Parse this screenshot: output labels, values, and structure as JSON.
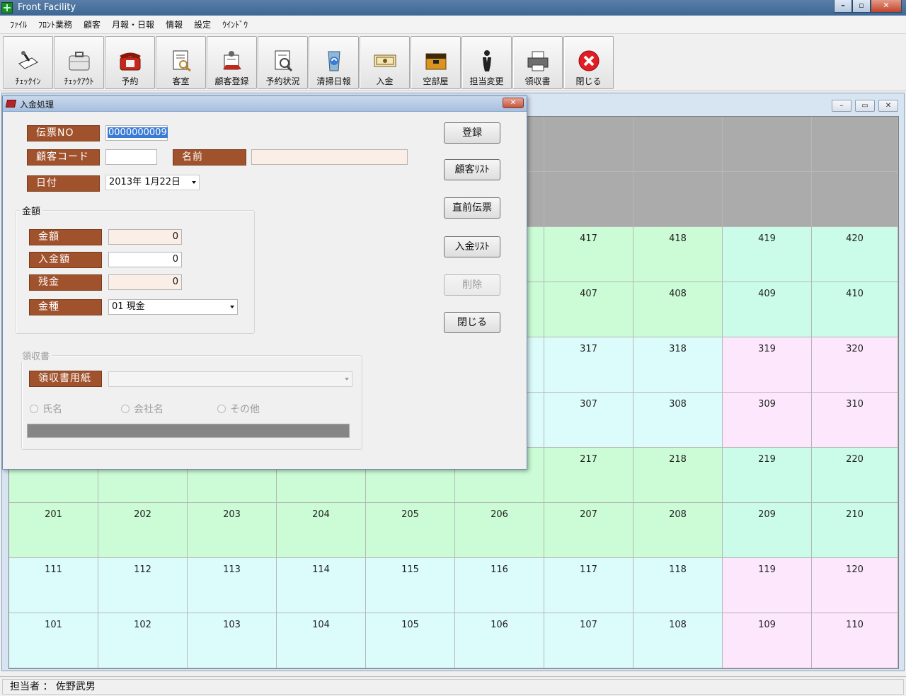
{
  "app": {
    "title": "Front Facility"
  },
  "menu": [
    "ﾌｧｲﾙ",
    "ﾌﾛﾝﾄ業務",
    "顧客",
    "月報・日報",
    "情報",
    "設定",
    "ｳｲﾝﾄﾞｳ"
  ],
  "toolbar": [
    {
      "label": "ﾁｪｯｸｲﾝ",
      "icon": "checkin-icon"
    },
    {
      "label": "ﾁｪｯｸｱｳﾄ",
      "icon": "checkout-icon"
    },
    {
      "label": "予約",
      "icon": "phone-icon"
    },
    {
      "label": "客室",
      "icon": "room-icon"
    },
    {
      "label": "顧客登録",
      "icon": "customer-register-icon"
    },
    {
      "label": "予約状況",
      "icon": "reservation-status-icon"
    },
    {
      "label": "清掃日報",
      "icon": "cleaning-icon"
    },
    {
      "label": "入金",
      "icon": "payment-icon"
    },
    {
      "label": "空部屋",
      "icon": "vacant-room-icon"
    },
    {
      "label": "担当変更",
      "icon": "staff-change-icon"
    },
    {
      "label": "領収書",
      "icon": "printer-icon"
    },
    {
      "label": "閉じる",
      "icon": "close-icon"
    }
  ],
  "grid": {
    "rows": [
      {
        "color": "gray",
        "cells": [
          "",
          "",
          "",
          "",
          "",
          "",
          "",
          "",
          "",
          ""
        ]
      },
      {
        "color": "gray",
        "cells": [
          "",
          "",
          "",
          "",
          "",
          "",
          "",
          "",
          "",
          ""
        ]
      },
      {
        "color": "mixed",
        "cells": [
          "",
          "",
          "",
          "",
          "",
          "",
          "417",
          "418",
          "419",
          "420"
        ],
        "cellColors": [
          "green",
          "green",
          "green",
          "green",
          "green",
          "green",
          "green",
          "green",
          "mint",
          "mint"
        ]
      },
      {
        "color": "mixed",
        "cells": [
          "",
          "",
          "",
          "",
          "",
          "",
          "407",
          "408",
          "409",
          "410"
        ],
        "cellColors": [
          "green",
          "green",
          "green",
          "green",
          "green",
          "green",
          "green",
          "green",
          "mint",
          "mint"
        ]
      },
      {
        "color": "mixed",
        "cells": [
          "",
          "",
          "",
          "",
          "",
          "",
          "317",
          "318",
          "319",
          "320"
        ],
        "cellColors": [
          "cyan",
          "cyan",
          "cyan",
          "cyan",
          "cyan",
          "cyan",
          "cyan",
          "cyan",
          "pink",
          "pink"
        ]
      },
      {
        "color": "mixed",
        "cells": [
          "",
          "",
          "",
          "",
          "",
          "",
          "307",
          "308",
          "309",
          "310"
        ],
        "cellColors": [
          "cyan",
          "cyan",
          "cyan",
          "cyan",
          "cyan",
          "cyan",
          "cyan",
          "cyan",
          "pink",
          "pink"
        ]
      },
      {
        "color": "mixed",
        "cells": [
          "",
          "",
          "",
          "",
          "",
          "",
          "217",
          "218",
          "219",
          "220"
        ],
        "cellColors": [
          "green",
          "green",
          "green",
          "green",
          "green",
          "green",
          "green",
          "green",
          "mint",
          "mint"
        ]
      },
      {
        "color": "mixed",
        "cells": [
          "201",
          "202",
          "203",
          "204",
          "205",
          "206",
          "207",
          "208",
          "209",
          "210"
        ],
        "cellColors": [
          "green",
          "green",
          "green",
          "green",
          "green",
          "green",
          "green",
          "green",
          "mint",
          "mint"
        ]
      },
      {
        "color": "mixed",
        "cells": [
          "111",
          "112",
          "113",
          "114",
          "115",
          "116",
          "117",
          "118",
          "119",
          "120"
        ],
        "cellColors": [
          "cyan",
          "cyan",
          "cyan",
          "cyan",
          "cyan",
          "cyan",
          "cyan",
          "cyan",
          "pink",
          "pink"
        ]
      },
      {
        "color": "mixed",
        "cells": [
          "101",
          "102",
          "103",
          "104",
          "105",
          "106",
          "107",
          "108",
          "109",
          "110"
        ],
        "cellColors": [
          "cyan",
          "cyan",
          "cyan",
          "cyan",
          "cyan",
          "cyan",
          "cyan",
          "cyan",
          "pink",
          "pink"
        ]
      }
    ],
    "colors": {
      "gray": "#ababab",
      "green": "#ccfcd6",
      "cyan": "#dcfcfc",
      "mint": "#cbfcea",
      "pink": "#fce7fc"
    }
  },
  "dialog": {
    "title": "入金処理",
    "slip_no_label": "伝票NO",
    "slip_no_value": "0000000009",
    "customer_code_label": "顧客コード",
    "customer_code_value": "",
    "name_label": "名前",
    "name_value": "",
    "date_label": "日付",
    "date_value": "2013年  1月22日",
    "amount_group": {
      "title": "金額",
      "amount_label": "金額",
      "amount_value": "0",
      "paid_label": "入金額",
      "paid_value": "0",
      "balance_label": "残金",
      "balance_value": "0",
      "type_label": "金種",
      "type_value": "01  現金"
    },
    "receipt_group": {
      "title": "領収書",
      "paper_label": "領収書用紙",
      "paper_value": "",
      "radio_name": "氏名",
      "radio_company": "会社名",
      "radio_other": "その他"
    },
    "buttons": {
      "register": "登録",
      "customer_list": "顧客ﾘｽﾄ",
      "previous_slip": "直前伝票",
      "payment_list": "入金ﾘｽﾄ",
      "delete": "削除",
      "close": "閉じる"
    }
  },
  "status": {
    "staff": "担当者 ： 佐野武男"
  }
}
